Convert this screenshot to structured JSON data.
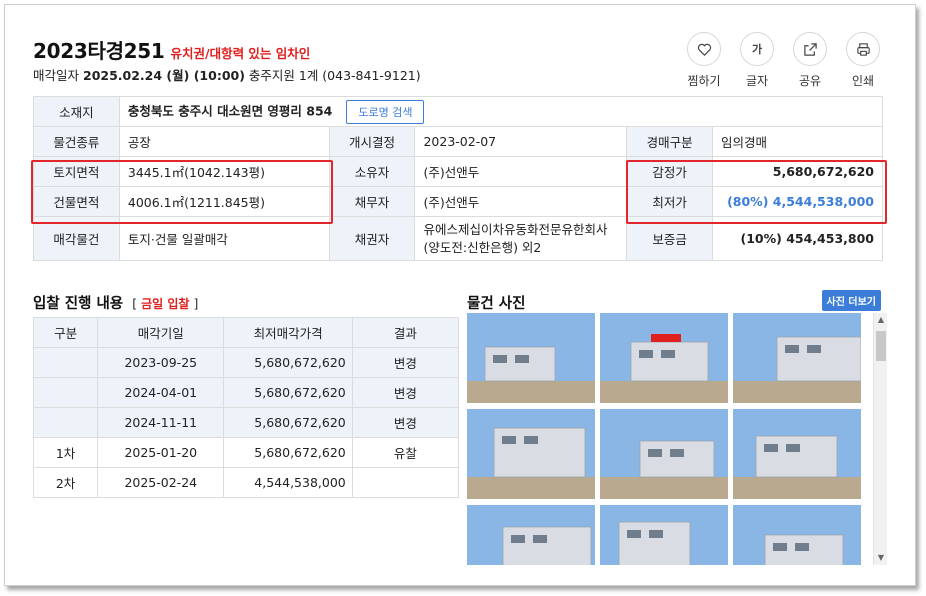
{
  "header": {
    "case_no": "2023타경251",
    "case_tag": "유치권/대항력 있는 임차인",
    "sale_label": "매각일자",
    "sale_date": "2025.02.24 (월) (10:00)",
    "court_info": "충주지원 1계 (043-841-9121)"
  },
  "actions": [
    {
      "label": "찜하기",
      "icon": "heart-icon"
    },
    {
      "label": "글자",
      "icon": "font-size-icon",
      "glyph": "가"
    },
    {
      "label": "공유",
      "icon": "share-icon"
    },
    {
      "label": "인쇄",
      "icon": "print-icon"
    }
  ],
  "info": {
    "location_label": "소재지",
    "location": "충청북도 충주시 대소원면 영평리 854",
    "road_btn": "도로명 검색",
    "type_label": "물건종류",
    "type": "공장",
    "start_label": "개시결정",
    "start": "2023-02-07",
    "auction_kind_label": "경매구분",
    "auction_kind": "임의경매",
    "land_label": "토지면적",
    "land": "3445.1㎡(1042.143평)",
    "owner_label": "소유자",
    "owner": "(주)선앤두",
    "appraisal_label": "감정가",
    "appraisal": "5,680,672,620",
    "building_label": "건물면적",
    "building": "4006.1㎡(1211.845평)",
    "debtor_label": "채무자",
    "debtor": "(주)선앤두",
    "min_label": "최저가",
    "min": "(80%) 4,544,538,000",
    "sale_item_label": "매각물건",
    "sale_item": "토지·건물 일괄매각",
    "creditor_label": "채권자",
    "creditor": "유에스제십이차유동화전문유한회사\n(양도전:신한은행) 외2",
    "deposit_label": "보증금",
    "deposit": "(10%) 454,453,800"
  },
  "bids": {
    "title": "입찰 진행 내용",
    "today_open": "[",
    "today": "금일 입찰",
    "today_close": "]",
    "headers": [
      "구분",
      "매각기일",
      "최저매각가격",
      "결과"
    ],
    "rows": [
      {
        "round": "",
        "date": "2023-09-25",
        "price": "5,680,672,620",
        "result": "변경"
      },
      {
        "round": "",
        "date": "2024-04-01",
        "price": "5,680,672,620",
        "result": "변경"
      },
      {
        "round": "",
        "date": "2024-11-11",
        "price": "5,680,672,620",
        "result": "변경"
      },
      {
        "round": "1차",
        "date": "2025-01-20",
        "price": "5,680,672,620",
        "result": "유찰"
      },
      {
        "round": "2차",
        "date": "2025-02-24",
        "price": "4,544,538,000",
        "result": ""
      }
    ]
  },
  "photos": {
    "title": "물건 사진",
    "more_btn": "사진 더보기",
    "scroll_up": "▲",
    "scroll_down": "▼",
    "colors": {
      "sky": "#8ab6e6",
      "building": "#d9dde3",
      "ground": "#b9a98f",
      "accent": "#e0201e"
    }
  }
}
